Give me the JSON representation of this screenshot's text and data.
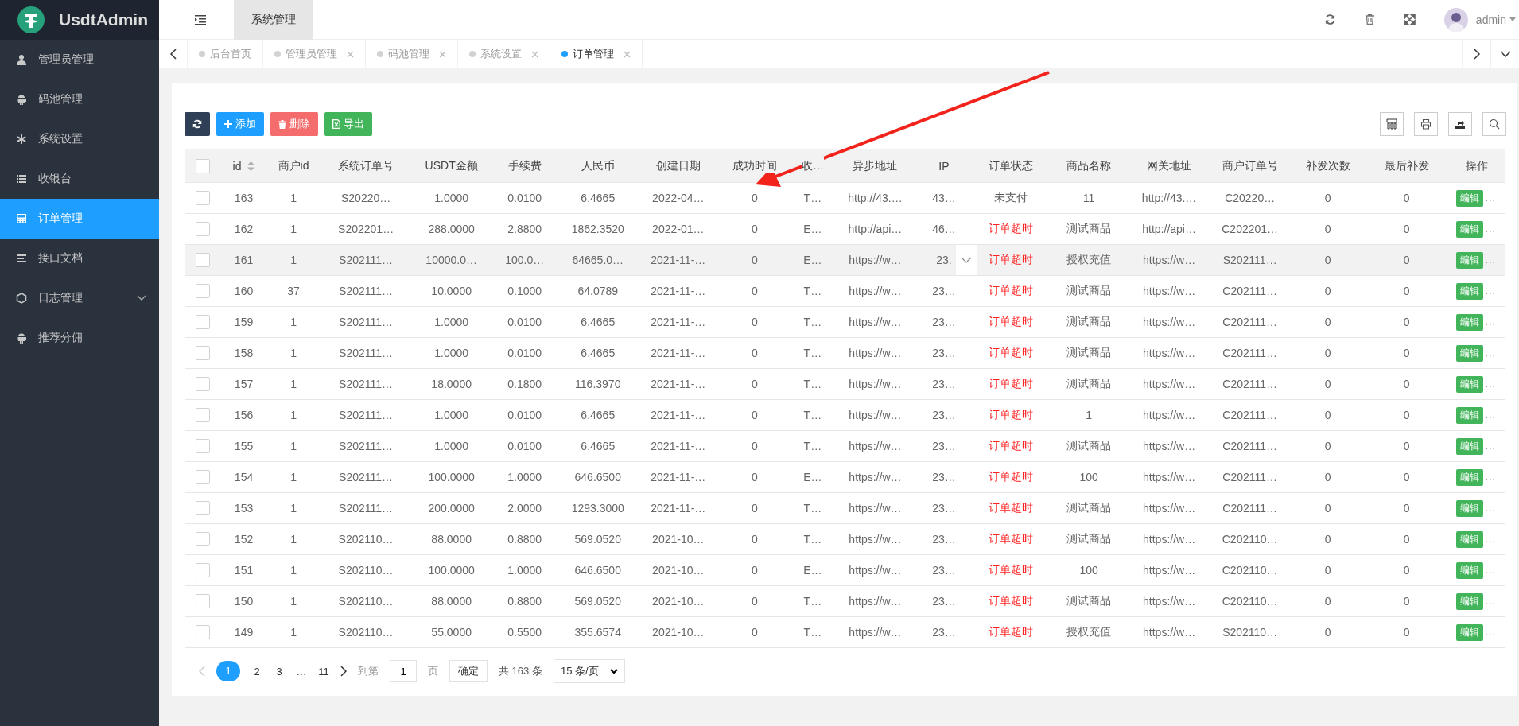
{
  "brand": {
    "name": "UsdtAdmin"
  },
  "topbar": {
    "tab": "系统管理",
    "user": "admin"
  },
  "sidebar": {
    "items": [
      {
        "label": "管理员管理",
        "selected": false,
        "expandable": false
      },
      {
        "label": "码池管理",
        "selected": false,
        "expandable": false
      },
      {
        "label": "系统设置",
        "selected": false,
        "expandable": false
      },
      {
        "label": "收银台",
        "selected": false,
        "expandable": false
      },
      {
        "label": "订单管理",
        "selected": true,
        "expandable": false
      },
      {
        "label": "接口文档",
        "selected": false,
        "expandable": false
      },
      {
        "label": "日志管理",
        "selected": false,
        "expandable": true
      },
      {
        "label": "推荐分佣",
        "selected": false,
        "expandable": false
      }
    ]
  },
  "tabs": [
    {
      "label": "后台首页",
      "selected": false,
      "closable": false
    },
    {
      "label": "管理员管理",
      "selected": false,
      "closable": true
    },
    {
      "label": "码池管理",
      "selected": false,
      "closable": true
    },
    {
      "label": "系统设置",
      "selected": false,
      "closable": true
    },
    {
      "label": "订单管理",
      "selected": true,
      "closable": true
    }
  ],
  "toolbar": {
    "add": "添加",
    "delete": "删除",
    "export": "导出"
  },
  "table": {
    "all_checked": false,
    "columns": [
      "id",
      "商户id",
      "系统订单号",
      "USDT金额",
      "手续费",
      "人民币",
      "创建日期",
      "成功时间",
      "收…",
      "异步地址",
      "IP",
      "订单状态",
      "商品名称",
      "网关地址",
      "商户订单号",
      "补发次数",
      "最后补发",
      "操作"
    ],
    "rows": [
      {
        "checked": false,
        "highlighted": false,
        "expander": false,
        "color": "#555555",
        "action": "编辑",
        "action_more": "…",
        "cells": [
          "163",
          "1",
          "S20220…",
          "1.0000",
          "0.0100",
          "6.4665",
          "2022-04…",
          "0",
          "T…",
          "http://43.…",
          "43…",
          "未支付",
          "11",
          "http://43.…",
          "C20220…",
          "0",
          "0"
        ]
      },
      {
        "checked": false,
        "highlighted": false,
        "expander": false,
        "color": "#ff2222",
        "action": "编辑",
        "action_more": "…",
        "cells": [
          "162",
          "1",
          "S202201…",
          "288.0000",
          "2.8800",
          "1862.3520",
          "2022-01…",
          "0",
          "E…",
          "http://api…",
          "46…",
          "订单超时",
          "测试商品",
          "http://api…",
          "C202201…",
          "0",
          "0"
        ]
      },
      {
        "checked": false,
        "highlighted": true,
        "expander": true,
        "color": "#ff2222",
        "action": "编辑",
        "action_more": "…",
        "cells": [
          "161",
          "1",
          "S202111…",
          "10000.0…",
          "100.0…",
          "64665.0…",
          "2021-11-…",
          "0",
          "E…",
          "https://w…",
          "23.",
          "订单超时",
          "授权充值",
          "https://w…",
          "S202111…",
          "0",
          "0"
        ]
      },
      {
        "checked": false,
        "highlighted": false,
        "expander": false,
        "color": "#ff2222",
        "action": "编辑",
        "action_more": "…",
        "cells": [
          "160",
          "37",
          "S202111…",
          "10.0000",
          "0.1000",
          "64.0789",
          "2021-11-…",
          "0",
          "T…",
          "https://w…",
          "23…",
          "订单超时",
          "测试商品",
          "https://w…",
          "C202111…",
          "0",
          "0"
        ]
      },
      {
        "checked": false,
        "highlighted": false,
        "expander": false,
        "color": "#ff2222",
        "action": "编辑",
        "action_more": "…",
        "cells": [
          "159",
          "1",
          "S202111…",
          "1.0000",
          "0.0100",
          "6.4665",
          "2021-11-…",
          "0",
          "T…",
          "https://w…",
          "23…",
          "订单超时",
          "测试商品",
          "https://w…",
          "C202111…",
          "0",
          "0"
        ]
      },
      {
        "checked": false,
        "highlighted": false,
        "expander": false,
        "color": "#ff2222",
        "action": "编辑",
        "action_more": "…",
        "cells": [
          "158",
          "1",
          "S202111…",
          "1.0000",
          "0.0100",
          "6.4665",
          "2021-11-…",
          "0",
          "T…",
          "https://w…",
          "23…",
          "订单超时",
          "测试商品",
          "https://w…",
          "C202111…",
          "0",
          "0"
        ]
      },
      {
        "checked": false,
        "highlighted": false,
        "expander": false,
        "color": "#ff2222",
        "action": "编辑",
        "action_more": "…",
        "cells": [
          "157",
          "1",
          "S202111…",
          "18.0000",
          "0.1800",
          "116.3970",
          "2021-11-…",
          "0",
          "T…",
          "https://w…",
          "23…",
          "订单超时",
          "测试商品",
          "https://w…",
          "C202111…",
          "0",
          "0"
        ]
      },
      {
        "checked": false,
        "highlighted": false,
        "expander": false,
        "color": "#ff2222",
        "action": "编辑",
        "action_more": "…",
        "cells": [
          "156",
          "1",
          "S202111…",
          "1.0000",
          "0.0100",
          "6.4665",
          "2021-11-…",
          "0",
          "T…",
          "https://w…",
          "23…",
          "订单超时",
          "1",
          "https://w…",
          "C202111…",
          "0",
          "0"
        ]
      },
      {
        "checked": false,
        "highlighted": false,
        "expander": false,
        "color": "#ff2222",
        "action": "编辑",
        "action_more": "…",
        "cells": [
          "155",
          "1",
          "S202111…",
          "1.0000",
          "0.0100",
          "6.4665",
          "2021-11-…",
          "0",
          "T…",
          "https://w…",
          "23…",
          "订单超时",
          "测试商品",
          "https://w…",
          "C202111…",
          "0",
          "0"
        ]
      },
      {
        "checked": false,
        "highlighted": false,
        "expander": false,
        "color": "#ff2222",
        "action": "编辑",
        "action_more": "…",
        "cells": [
          "154",
          "1",
          "S202111…",
          "100.0000",
          "1.0000",
          "646.6500",
          "2021-11-…",
          "0",
          "E…",
          "https://w…",
          "23…",
          "订单超时",
          "100",
          "https://w…",
          "C202111…",
          "0",
          "0"
        ]
      },
      {
        "checked": false,
        "highlighted": false,
        "expander": false,
        "color": "#ff2222",
        "action": "编辑",
        "action_more": "…",
        "cells": [
          "153",
          "1",
          "S202111…",
          "200.0000",
          "2.0000",
          "1293.3000",
          "2021-11-…",
          "0",
          "T…",
          "https://w…",
          "23…",
          "订单超时",
          "测试商品",
          "https://w…",
          "C202111…",
          "0",
          "0"
        ]
      },
      {
        "checked": false,
        "highlighted": false,
        "expander": false,
        "color": "#ff2222",
        "action": "编辑",
        "action_more": "…",
        "cells": [
          "152",
          "1",
          "S202110…",
          "88.0000",
          "0.8800",
          "569.0520",
          "2021-10…",
          "0",
          "T…",
          "https://w…",
          "23…",
          "订单超时",
          "测试商品",
          "https://w…",
          "C202110…",
          "0",
          "0"
        ]
      },
      {
        "checked": false,
        "highlighted": false,
        "expander": false,
        "color": "#ff2222",
        "action": "编辑",
        "action_more": "…",
        "cells": [
          "151",
          "1",
          "S202110…",
          "100.0000",
          "1.0000",
          "646.6500",
          "2021-10…",
          "0",
          "E…",
          "https://w…",
          "23…",
          "订单超时",
          "100",
          "https://w…",
          "C202110…",
          "0",
          "0"
        ]
      },
      {
        "checked": false,
        "highlighted": false,
        "expander": false,
        "color": "#ff2222",
        "action": "编辑",
        "action_more": "…",
        "cells": [
          "150",
          "1",
          "S202110…",
          "88.0000",
          "0.8800",
          "569.0520",
          "2021-10…",
          "0",
          "T…",
          "https://w…",
          "23…",
          "订单超时",
          "测试商品",
          "https://w…",
          "C202110…",
          "0",
          "0"
        ]
      },
      {
        "checked": false,
        "highlighted": false,
        "expander": false,
        "color": "#ff2222",
        "action": "编辑",
        "action_more": "…",
        "cells": [
          "149",
          "1",
          "S202110…",
          "55.0000",
          "0.5500",
          "355.6574",
          "2021-10…",
          "0",
          "T…",
          "https://w…",
          "23…",
          "订单超时",
          "授权充值",
          "https://w…",
          "S202110…",
          "0",
          "0"
        ]
      }
    ]
  },
  "pagination": {
    "pages": [
      {
        "label": "1",
        "selected": true
      },
      {
        "label": "2",
        "selected": false
      },
      {
        "label": "3",
        "selected": false
      },
      {
        "label": "…",
        "selected": false
      },
      {
        "label": "11",
        "selected": false
      }
    ],
    "goto_label": "到第",
    "goto_value": "1",
    "page_unit": "页",
    "confirm": "确定",
    "total": "共 163 条",
    "page_size": "15 条/页"
  }
}
